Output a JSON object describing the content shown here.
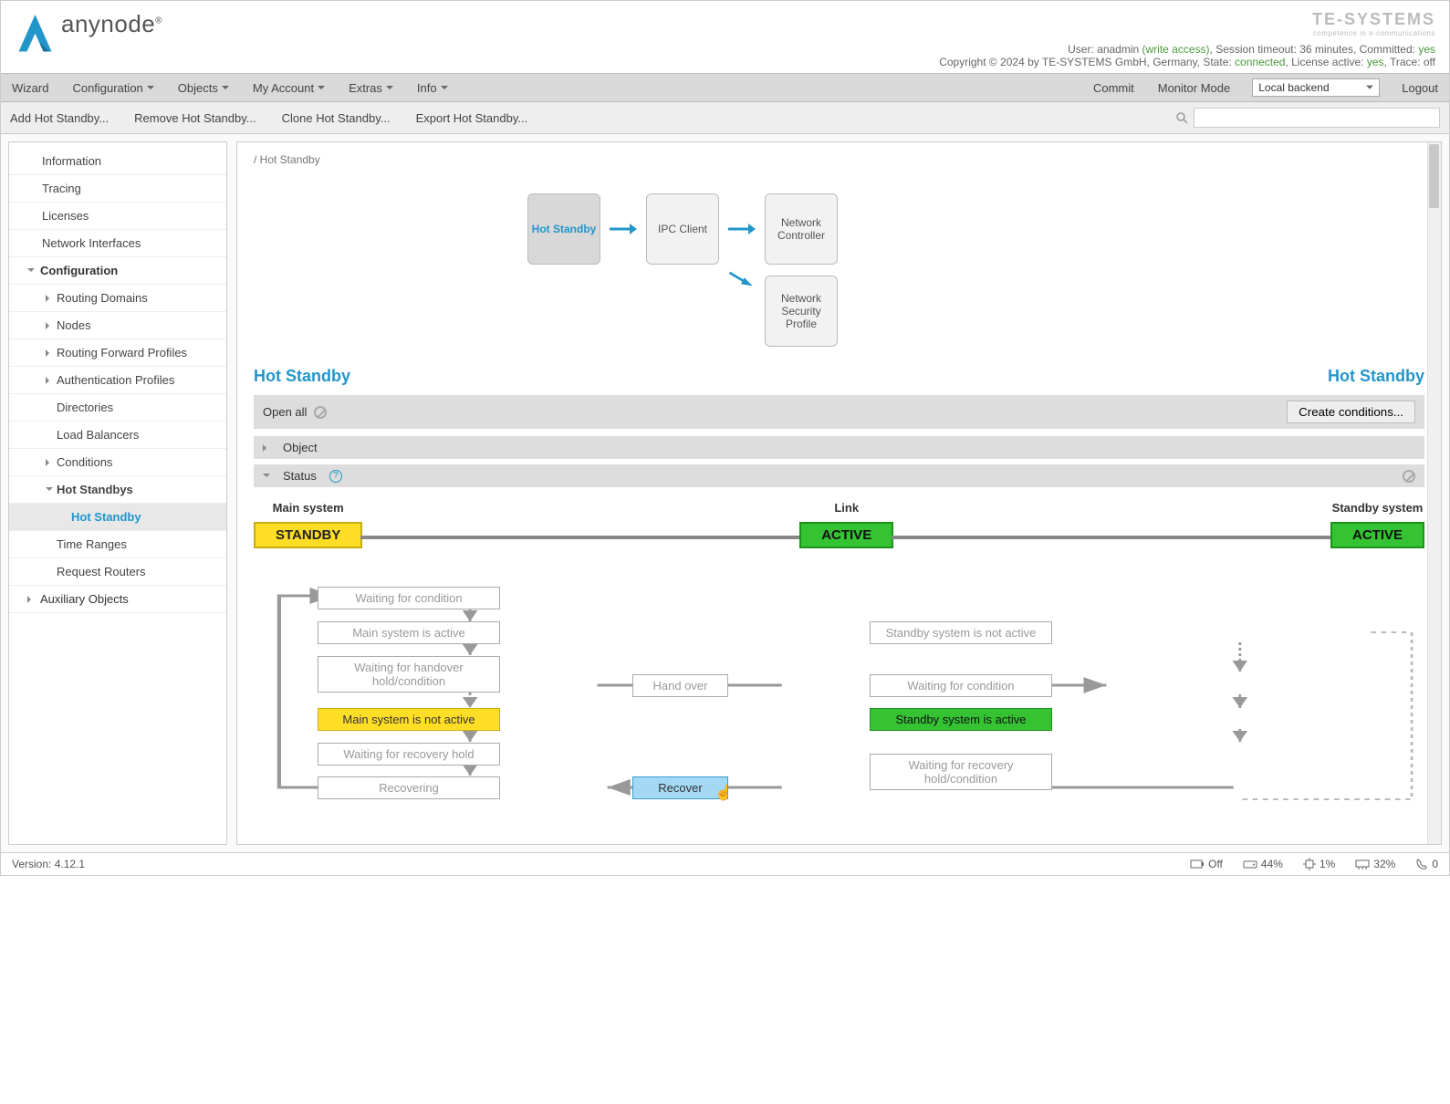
{
  "logo_text": "anynode",
  "te_logo": "TE-SYSTEMS",
  "te_sub": "competence in e-communications",
  "userline": {
    "user_label": "User: ",
    "user": "anadmin",
    "access": "(write access)",
    "sess_label": ", Session timeout: ",
    "sess": "36 minutes",
    "committed_label": ", Committed: ",
    "committed": "yes"
  },
  "copyright_pre": "Copyright © 2024 by TE-SYSTEMS GmbH, Germany, State: ",
  "state": "connected",
  "license_label": ", License active: ",
  "license": "yes",
  "trace_label": ", Trace: ",
  "trace": "off",
  "menu": {
    "wizard": "Wizard",
    "configuration": "Configuration",
    "objects": "Objects",
    "myaccount": "My Account",
    "extras": "Extras",
    "info": "Info",
    "commit": "Commit",
    "monitor": "Monitor Mode",
    "backend": "Local backend",
    "logout": "Logout"
  },
  "toolbar": {
    "add": "Add Hot Standby...",
    "remove": "Remove Hot Standby...",
    "clone": "Clone Hot Standby...",
    "export": "Export Hot Standby..."
  },
  "sidebar": {
    "information": "Information",
    "tracing": "Tracing",
    "licenses": "Licenses",
    "netif": "Network Interfaces",
    "config": "Configuration",
    "routing": "Routing Domains",
    "nodes": "Nodes",
    "rfp": "Routing Forward Profiles",
    "auth": "Authentication Profiles",
    "dirs": "Directories",
    "lb": "Load Balancers",
    "cond": "Conditions",
    "hs": "Hot Standbys",
    "hs_item": "Hot Standby",
    "timeranges": "Time Ranges",
    "reqrouters": "Request Routers",
    "aux": "Auxiliary Objects"
  },
  "breadcrumb": "/ Hot Standby",
  "diagram": {
    "hs": "Hot Standby",
    "ipc": "IPC Client",
    "nc": "Network Controller",
    "nsp": "Network Security Profile"
  },
  "section_left": "Hot Standby",
  "section_right": "Hot Standby",
  "open_all": "Open all",
  "create_cond": "Create conditions...",
  "panel_object": "Object",
  "panel_status": "Status",
  "status": {
    "main_label": "Main system",
    "main_val": "STANDBY",
    "link_label": "Link",
    "link_val": "ACTIVE",
    "standby_label": "Standby system",
    "standby_val": "ACTIVE"
  },
  "states": {
    "s1": "Waiting for condition",
    "s2": "Main system is active",
    "s3": "Waiting for handover hold/condition",
    "s4": "Main system is not active",
    "s5": "Waiting for recovery hold",
    "s6": "Recovering",
    "handover": "Hand over",
    "recover": "Recover",
    "r1": "Standby system is not active",
    "r2": "Waiting for condition",
    "r3": "Standby system is active",
    "r4": "Waiting for recovery hold/condition"
  },
  "footer": {
    "version_label": "Version: ",
    "version": "4.12.1",
    "off": "Off",
    "disk": "44%",
    "cpu": "1%",
    "mem": "32%",
    "calls": "0"
  }
}
